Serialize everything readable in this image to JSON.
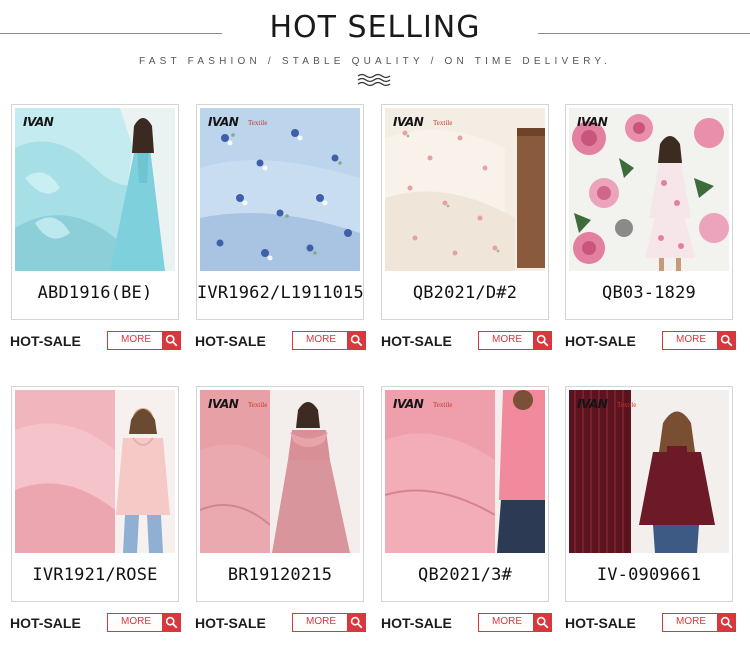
{
  "header": {
    "title": "HOT SELLING",
    "subtitle": "FAST FASHION / STABLE QUALITY / ON TIME DELIVERY.",
    "wave_icon": "wave-icon"
  },
  "brand": {
    "logo": "IVAN",
    "sub": "Textile"
  },
  "labels": {
    "hot_sale": "HOT-SALE",
    "more": "MORE",
    "search_icon": "search-icon"
  },
  "products": [
    {
      "code": "ABD1916(BE)",
      "image": "fabric-photo-aqua-satin-gown"
    },
    {
      "code": "IVR1962/L1911015",
      "image": "fabric-photo-blue-floral"
    },
    {
      "code": "QB2021/D#2",
      "image": "fabric-photo-cream-floral"
    },
    {
      "code": "QB03-1829",
      "image": "fabric-photo-rose-print-dress"
    },
    {
      "code": "IVR1921/ROSE",
      "image": "fabric-photo-pink-hoodie"
    },
    {
      "code": "BR19120215",
      "image": "fabric-photo-pink-crepe-gown"
    },
    {
      "code": "QB2021/3#",
      "image": "fabric-photo-pink-knit"
    },
    {
      "code": "IV-0909661",
      "image": "fabric-photo-burgundy-rib"
    }
  ]
}
